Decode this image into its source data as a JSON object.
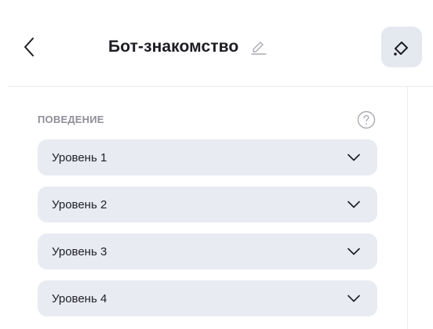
{
  "header": {
    "title": "Бот-знакомство",
    "icons": {
      "back": "back-arrow-icon",
      "edit": "pencil-icon",
      "tool": "eraser-icon"
    }
  },
  "behavior": {
    "section_label": "ПОВЕДЕНИЕ",
    "help_icon": "question-circle-icon",
    "levels": [
      {
        "label": "Уровень 1"
      },
      {
        "label": "Уровень 2"
      },
      {
        "label": "Уровень 3"
      },
      {
        "label": "Уровень 4"
      }
    ]
  },
  "colors": {
    "accent_bg": "#e4e8ef",
    "item_bg": "#e8ebf1",
    "muted_text": "#8e8f99"
  }
}
